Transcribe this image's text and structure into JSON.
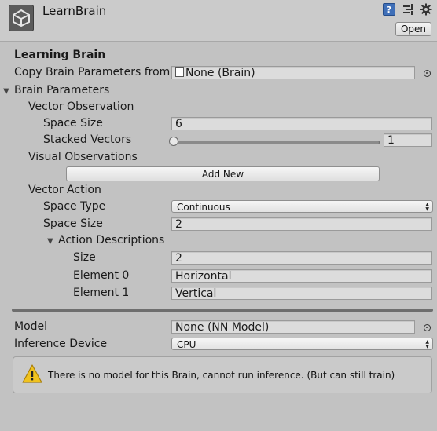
{
  "header": {
    "title": "LearnBrain",
    "open_label": "Open",
    "help_icon_glyph": "?",
    "icons": [
      "unity-logo-icon",
      "help-icon",
      "preset-icon",
      "gear-icon"
    ]
  },
  "learning_brain": {
    "heading": "Learning Brain",
    "copy_brain_label": "Copy Brain Parameters from",
    "copy_brain_value": "None (Brain)"
  },
  "brain_parameters": {
    "heading": "Brain Parameters",
    "vector_observation": {
      "heading": "Vector Observation",
      "space_size_label": "Space Size",
      "space_size_value": "6",
      "stacked_vectors_label": "Stacked Vectors",
      "stacked_vectors_value": "1",
      "stacked_vectors_slider_position": 0
    },
    "visual_observations": {
      "heading": "Visual Observations",
      "add_new_label": "Add New"
    },
    "vector_action": {
      "heading": "Vector Action",
      "space_type_label": "Space Type",
      "space_type_value": "Continuous",
      "space_size_label": "Space Size",
      "space_size_value": "2",
      "action_descriptions": {
        "heading": "Action Descriptions",
        "size_label": "Size",
        "size_value": "2",
        "elements": [
          {
            "label": "Element 0",
            "value": "Horizontal"
          },
          {
            "label": "Element 1",
            "value": "Vertical"
          }
        ]
      }
    }
  },
  "model": {
    "label": "Model",
    "value": "None (NN Model)"
  },
  "inference_device": {
    "label": "Inference Device",
    "value": "CPU"
  },
  "helpbox": {
    "text": "There is no model for this Brain, cannot run inference. (But can still train)"
  },
  "colors": {
    "background": "#c2c2c2",
    "header": "#cbcbcb",
    "help_icon": "#3f6fb8",
    "warning": "#f0c21e"
  }
}
